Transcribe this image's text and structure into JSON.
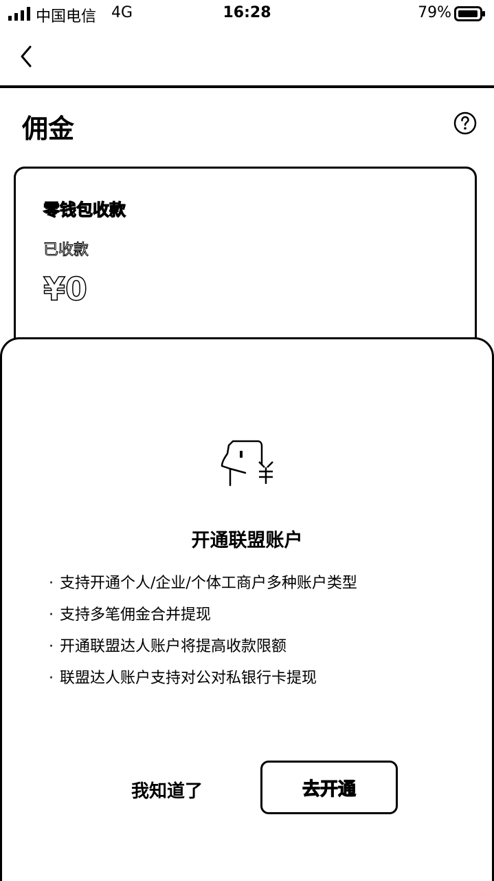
{
  "status_bar": {
    "carrier": "中国电信",
    "network": "4G",
    "time": "16:28",
    "battery": "79%"
  },
  "nav": {
    "back_icon": "chevron-left-icon"
  },
  "header": {
    "title": "佣金",
    "help_icon": "question-circle-icon"
  },
  "card": {
    "title": "零钱包收款",
    "subtitle": "已收款",
    "amount": "¥0"
  },
  "sheet": {
    "illustration_icon": "face-yuan-icon",
    "title": "开通联盟账户",
    "features": [
      "支持开通个人/企业/个体工商户多种账户类型",
      "支持多笔佣金合并提现",
      "开通联盟达人账户将提高收款限额",
      "联盟达人账户支持对公对私银行卡提现"
    ],
    "bullet": "·",
    "dismiss_label": "我知道了",
    "open_label": "去开通"
  }
}
